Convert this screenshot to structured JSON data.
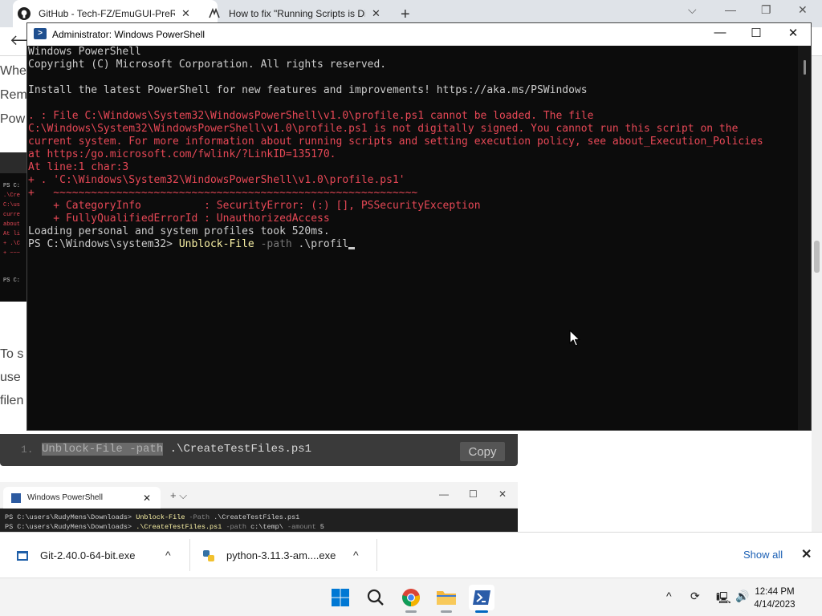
{
  "browser": {
    "tabs": [
      {
        "label": "GitHub - Tech-FZ/EmuGUI-PreRe",
        "icon": "github-icon"
      },
      {
        "label": "How to fix \"Running Scripts is Di",
        "icon": "site-logo-icon"
      }
    ],
    "new_tab_symbol": "+",
    "window_controls": {
      "chevron": "⌵",
      "minimize": "—",
      "restore": "❐",
      "close": "✕"
    }
  },
  "article": {
    "fragments": [
      "Whe",
      "Rem",
      "Pow",
      "To s",
      "use",
      "filen"
    ]
  },
  "article_image": {
    "lines": [
      {
        "text": "PS C:",
        "color": "#cccccc"
      },
      {
        "text": ".\\Cre",
        "color": "#e74856"
      },
      {
        "text": "C:\\us",
        "color": "#e74856"
      },
      {
        "text": "curre",
        "color": "#e74856"
      },
      {
        "text": "about",
        "color": "#e74856"
      },
      {
        "text": "At li",
        "color": "#e74856"
      },
      {
        "text": "+ .\\C",
        "color": "#e74856"
      },
      {
        "text": "+ ~~~",
        "color": "#e74856"
      },
      {
        "text": "PS C:",
        "color": "#cccccc"
      }
    ]
  },
  "code_snippet": {
    "line_number": "1.",
    "highlighted": "Unblock-File -path",
    "rest": " .\\CreateTestFiles.ps1",
    "copy_label": "Copy"
  },
  "terminal_screenshot": {
    "tab_title": "Windows PowerShell",
    "tab_close": "✕",
    "new_tab": "+  ⌵",
    "controls": {
      "minimize": "—",
      "maximize": "☐",
      "close": "✕"
    },
    "line1": {
      "prompt": "PS C:\\users\\RudyMens\\Downloads> ",
      "cmd": "Unblock-File",
      "param": " -Path",
      "rest": " .\\CreateTestFiles.ps1"
    },
    "line2": {
      "prompt": "PS C:\\users\\RudyMens\\Downloads> ",
      "cmd": ".\\CreateTestFiles.ps1",
      "param1": " -path",
      "mid": " c:\\temp\\",
      "param2": " -amount",
      "rest": " 5"
    }
  },
  "powershell": {
    "title": "Administrator: Windows PowerShell",
    "controls": {
      "minimize": "—",
      "maximize": "☐",
      "close": "✕"
    },
    "lines": {
      "l1": "Windows PowerShell",
      "l2": "Copyright (C) Microsoft Corporation. All rights reserved.",
      "l3": "",
      "l4": "Install the latest PowerShell for new features and improvements! https://aka.ms/PSWindows",
      "l5": "",
      "e1": ". : File C:\\Windows\\System32\\WindowsPowerShell\\v1.0\\profile.ps1 cannot be loaded. The file",
      "e2": "C:\\Windows\\System32\\WindowsPowerShell\\v1.0\\profile.ps1 is not digitally signed. You cannot run this script on the",
      "e3": "current system. For more information about running scripts and setting execution policy, see about_Execution_Policies",
      "e4": "at https:/go.microsoft.com/fwlink/?LinkID=135170.",
      "e5": "At line:1 char:3",
      "e6": "+ . 'C:\\Windows\\System32\\WindowsPowerShell\\v1.0\\profile.ps1'",
      "e7": "+   ~~~~~~~~~~~~~~~~~~~~~~~~~~~~~~~~~~~~~~~~~~~~~~~~~~~~~~~~~~",
      "e8": "    + CategoryInfo          : SecurityError: (:) [], PSSecurityException",
      "e9": "    + FullyQualifiedErrorId : UnauthorizedAccess",
      "l6": "Loading personal and system profiles took 520ms.",
      "prompt": "PS C:\\Windows\\system32> ",
      "cmd": "Unblock-File",
      "param": " -path",
      "arg": " .\\profil"
    }
  },
  "downloads": {
    "items": [
      {
        "name": "Git-2.40.0-64-bit.exe",
        "icon": "installer-icon",
        "chevron": "^"
      },
      {
        "name": "python-3.11.3-am....exe",
        "icon": "python-icon",
        "chevron": "^"
      }
    ],
    "show_all": "Show all",
    "close": "✕"
  },
  "taskbar": {
    "apps": [
      {
        "name": "start",
        "icon": "windows-start-icon"
      },
      {
        "name": "search",
        "icon": "search-icon"
      },
      {
        "name": "chrome",
        "icon": "chrome-icon"
      },
      {
        "name": "file-explorer",
        "icon": "folder-icon"
      },
      {
        "name": "powershell",
        "icon": "powershell-icon"
      }
    ],
    "tray": {
      "chevron": "^",
      "sync": "⟳",
      "network": "🖳",
      "volume": "🔊"
    },
    "clock": {
      "time": "12:44 PM",
      "date": "4/14/2023"
    }
  },
  "colors": {
    "console_bg": "#0c0c0c",
    "console_text": "#cccccc",
    "error_text": "#e74856",
    "command_text": "#f9f1a5",
    "parameter_text": "#767676",
    "link_blue": "#1a5fb4"
  }
}
